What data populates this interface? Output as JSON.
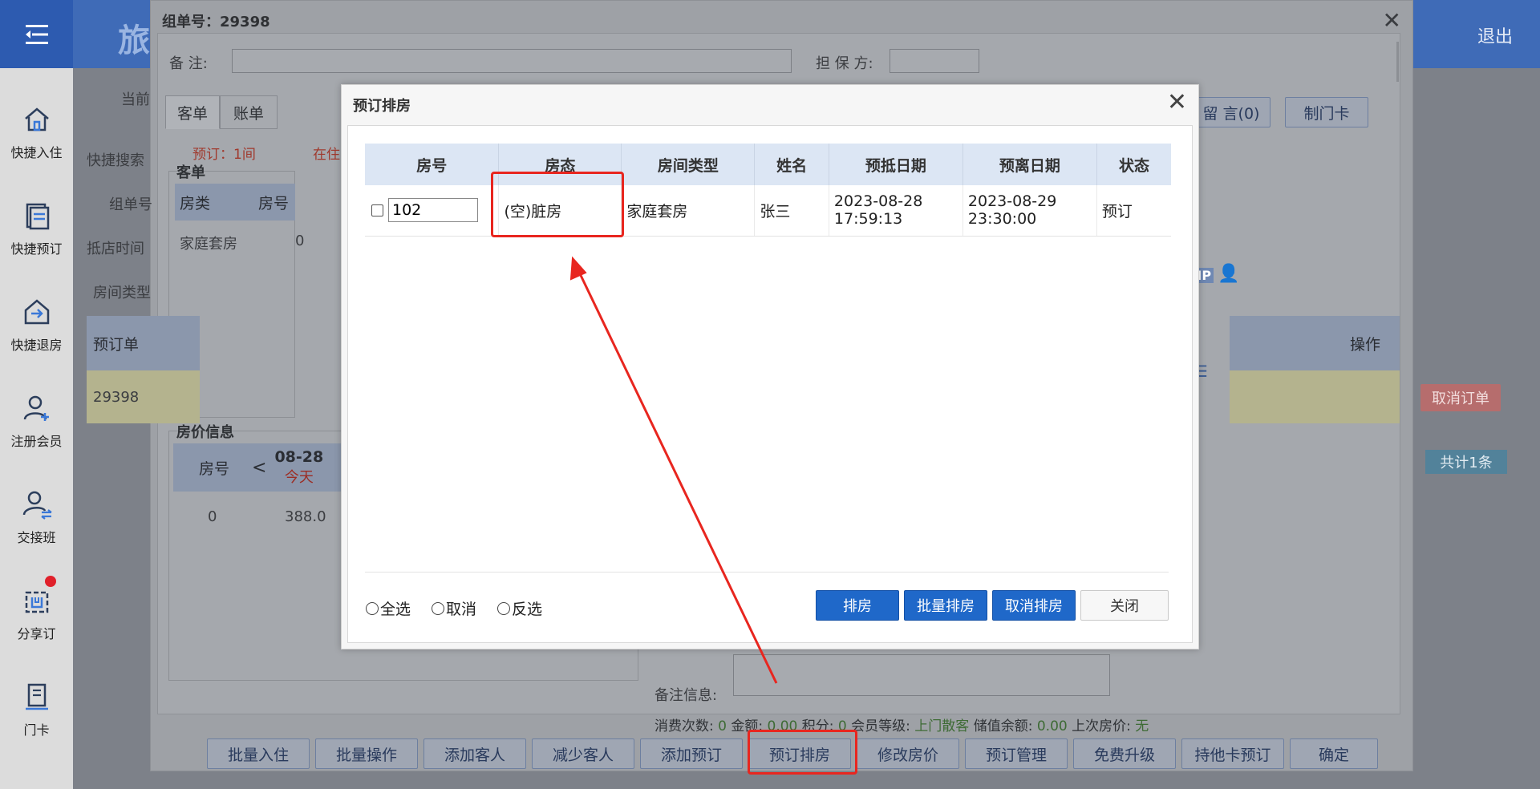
{
  "app": {
    "brand_partial": "旅",
    "exit": "退出"
  },
  "sidebar": {
    "items": [
      {
        "label": "快捷入住",
        "icon": "home-icon"
      },
      {
        "label": "快捷预订",
        "icon": "document-icon"
      },
      {
        "label": "快捷退房",
        "icon": "checkout-icon"
      },
      {
        "label": "注册会员",
        "icon": "add-user-icon"
      },
      {
        "label": "交接班",
        "icon": "shift-swap-icon"
      },
      {
        "label": "分享订",
        "icon": "share-order-icon"
      },
      {
        "label": "门卡",
        "icon": "card-icon"
      }
    ]
  },
  "group_dialog": {
    "title": "组单号：29398",
    "remark_label": "备    注:",
    "guarantor_label": "担 保 方:",
    "tabs": [
      "客单",
      "账单"
    ],
    "current_label": "当前",
    "quick_search_label": "快捷搜索",
    "group_no_label": "组单号",
    "arrival_label": "抵店时间",
    "room_type_label": "房间类型",
    "summary_reserved": "预订：1间",
    "summary_inhouse": "在住",
    "guest_section": "客单",
    "guest_grid": {
      "headers": [
        "房类",
        "房号"
      ],
      "rows": [
        [
          "家庭套房",
          "0"
        ]
      ]
    },
    "order_grid": {
      "header": "预订单",
      "row": "29398",
      "op_header": "操作",
      "cancel_btn": "取消订单",
      "total": "共计1条"
    },
    "price_section": "房价信息",
    "price_grid": {
      "room_header": "房号",
      "date": "08-28",
      "today": "今天",
      "room": "0",
      "price": "388.0"
    },
    "right_buttons": [
      "留 言(0)",
      "制门卡"
    ],
    "vip_badge": "VIP",
    "remarks_label": "备注信息:",
    "stats": {
      "count_label": "消费次数:",
      "count": "0",
      "amount_label": "金额:",
      "amount": "0.00",
      "points_label": "积分:",
      "points": "0",
      "level_label": "会员等级:",
      "level": "上门散客",
      "balance_label": "储值余额:",
      "balance": "0.00",
      "last_price_label": "上次房价:",
      "last_price": "无"
    },
    "bottom_buttons": [
      "批量入住",
      "批量操作",
      "添加客人",
      "减少客人",
      "添加预订",
      "预订排房",
      "修改房价",
      "预订管理",
      "免费升级",
      "持他卡预订",
      "确定"
    ]
  },
  "modal": {
    "title": "预订排房",
    "columns": [
      "房号",
      "房态",
      "房间类型",
      "姓名",
      "预抵日期",
      "预离日期",
      "状态"
    ],
    "rows": [
      {
        "room_no": "102",
        "room_state": "(空)脏房",
        "room_type": "家庭套房",
        "name": "张三",
        "arrive": "2023-08-28",
        "arrive_time": "17:59:13",
        "depart": "2023-08-29",
        "depart_time": "23:30:00",
        "status": "预订"
      }
    ],
    "radios": [
      "全选",
      "取消",
      "反选"
    ],
    "buttons": {
      "assign": "排房",
      "batch_assign": "批量排房",
      "cancel_assign": "取消排房",
      "close": "关闭"
    }
  },
  "colors": {
    "accent_blue": "#1f68c9",
    "annotation_red": "#e8261f",
    "header_blue": "#3f6bb7"
  }
}
